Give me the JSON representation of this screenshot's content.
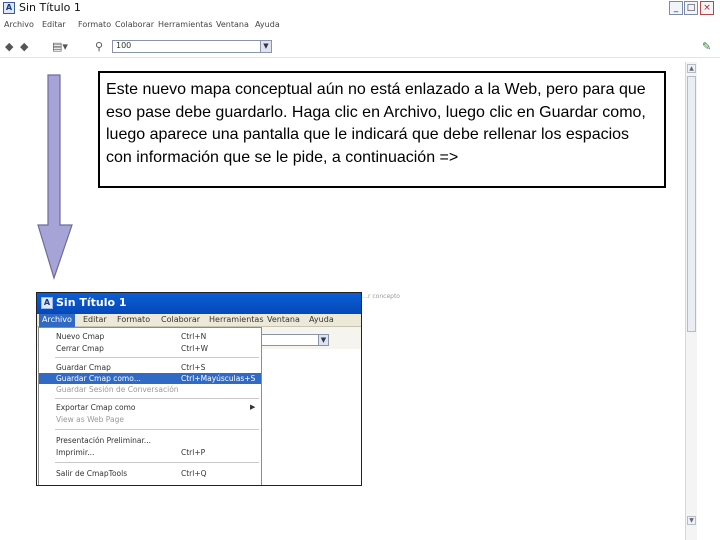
{
  "window": {
    "title": "Sin Título 1",
    "app_icon": "cmap-app-icon",
    "minimize": "_",
    "maximize": "□",
    "close": "×"
  },
  "menubar": {
    "items": [
      "Archivo",
      "Editar",
      "Formato",
      "Colaborar",
      "Herramientas",
      "Ventana",
      "Ayuda"
    ]
  },
  "toolbar": {
    "back_icon": "arrow-left-icon",
    "forward_icon": "arrow-right-icon",
    "dropdown_icon": "list-dropdown-icon",
    "zoom_icon": "magnifier-icon",
    "zoom_value": "100",
    "right_icon": "map-icon"
  },
  "callout": {
    "text": "Este nuevo mapa conceptual aún no está enlazado a la Web, pero para que eso pase debe guardarlo. Haga clic en Archivo, luego clic en Guardar como, luego aparece una pantalla que le indicará que debe rellenar los espacios con información que se le pide, a continuación =>"
  },
  "arrow": {
    "color": "#a6a4d6",
    "direction": "down"
  },
  "ghost_label": "…r concepto",
  "embedded": {
    "title": "Sin Título 1",
    "menus": [
      "Archivo",
      "Editar",
      "Formato",
      "Colaborar",
      "Herramientas",
      "Ventana",
      "Ayuda"
    ],
    "active_menu": "Archivo",
    "file_menu": [
      {
        "label": "Nuevo Cmap",
        "shortcut": "Ctrl+N",
        "state": "normal"
      },
      {
        "label": "Cerrar Cmap",
        "shortcut": "Ctrl+W",
        "state": "normal"
      },
      {
        "separator": true
      },
      {
        "label": "Guardar Cmap",
        "shortcut": "Ctrl+S",
        "state": "normal"
      },
      {
        "label": "Guardar Cmap como...",
        "shortcut": "Ctrl+Mayúsculas+S",
        "state": "selected"
      },
      {
        "label": "Guardar Sesión de Conversación",
        "shortcut": "",
        "state": "disabled"
      },
      {
        "separator": true
      },
      {
        "label": "Exportar Cmap como",
        "shortcut": "",
        "state": "normal",
        "submenu": "▶"
      },
      {
        "label": "View as Web Page",
        "shortcut": "",
        "state": "disabled"
      },
      {
        "separator": true
      },
      {
        "label": "Presentación Preliminar...",
        "shortcut": "",
        "state": "normal"
      },
      {
        "label": "Imprimir...",
        "shortcut": "Ctrl+P",
        "state": "normal"
      },
      {
        "separator": true
      },
      {
        "label": "Salir de CmapTools",
        "shortcut": "Ctrl+Q",
        "state": "normal"
      }
    ]
  }
}
